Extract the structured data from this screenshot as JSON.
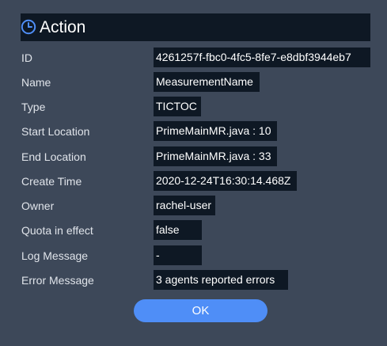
{
  "dialog": {
    "title": "Action",
    "title_icon": "clock-icon",
    "accent_color": "#4f8ef7",
    "fields": [
      {
        "label": "ID",
        "value": "4261257f-fbc0-4fc5-8fe7-e8dbf3944eb7"
      },
      {
        "label": "Name",
        "value": "MeasurementName"
      },
      {
        "label": "Type",
        "value": "TICTOC"
      },
      {
        "label": "Start Location",
        "value": "PrimeMainMR.java : 10"
      },
      {
        "label": "End Location",
        "value": "PrimeMainMR.java : 33"
      },
      {
        "label": "Create Time",
        "value": "2020-12-24T16:30:14.468Z"
      },
      {
        "label": "Owner",
        "value": "rachel-user"
      },
      {
        "label": "Quota in effect",
        "value": "false"
      },
      {
        "label": "Log Message",
        "value": "-"
      },
      {
        "label": "Error Message",
        "value": "3 agents reported errors"
      }
    ],
    "ok_label": "OK"
  }
}
